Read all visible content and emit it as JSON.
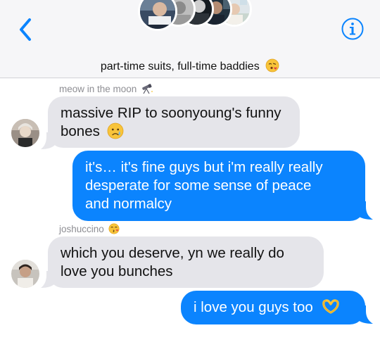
{
  "header": {
    "group_name": "part-time suits, full-time baddies",
    "group_emoji": "face-blowing-kiss-emoji",
    "back_icon": "chevron-left-icon",
    "info_icon": "info-icon",
    "avatar_count": 5
  },
  "colors": {
    "accent": "#0b84fe",
    "incoming_bubble": "#e5e5ea",
    "header_bg": "#f6f6f8",
    "meta_text": "#8e8e93"
  },
  "messages": [
    {
      "sender": "meow in the moon",
      "sender_emoji": "telescope-emoji",
      "direction": "incoming",
      "lines": [
        "massive RIP to soonyoung's funny",
        "bones"
      ],
      "emoji": "crying-face-emoji"
    },
    {
      "direction": "outgoing",
      "lines": [
        "it's… it's fine guys but i'm really really",
        "desperate for some sense of peace",
        "and normalcy"
      ]
    },
    {
      "sender": "joshuccino",
      "sender_emoji": "kissing-face-emoji",
      "direction": "incoming",
      "lines": [
        "which you deserve, yn we really do",
        "love you bunches"
      ]
    },
    {
      "direction": "outgoing",
      "lines": [
        "i love you guys too"
      ],
      "emoji": "heart-hands-emoji"
    }
  ]
}
